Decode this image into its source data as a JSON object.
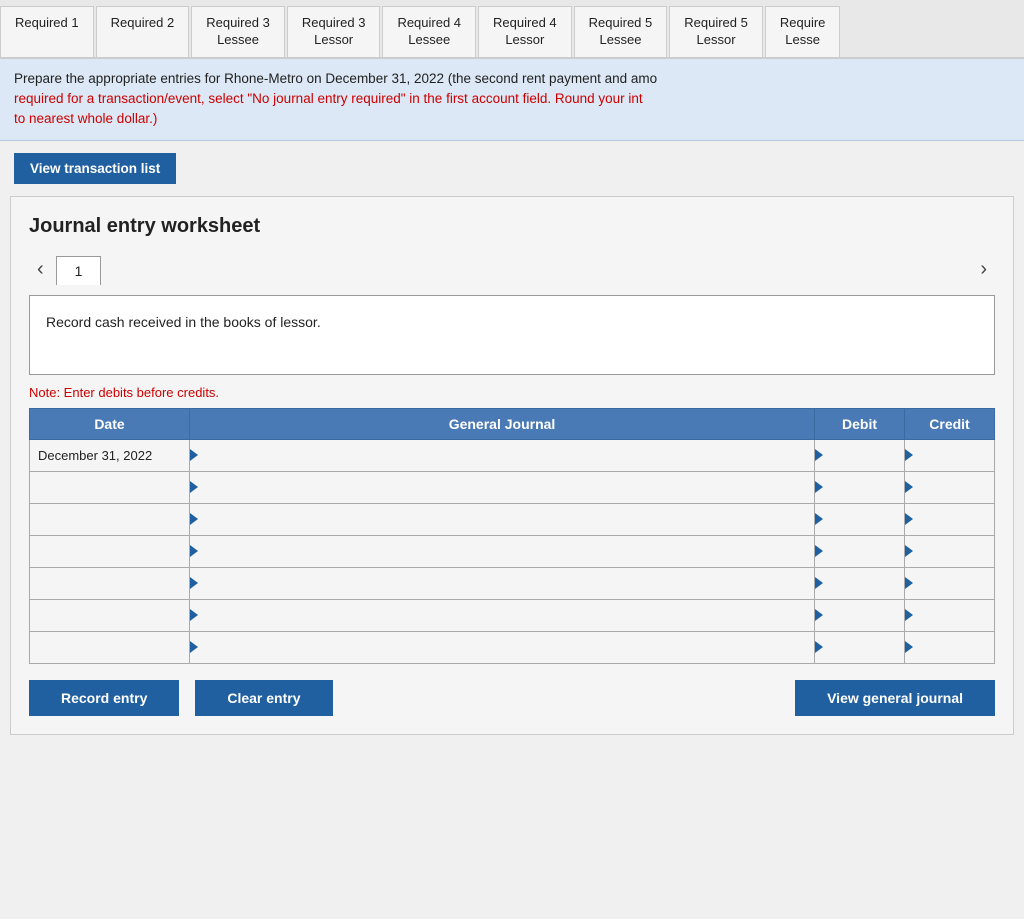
{
  "tabs": [
    {
      "id": "req1",
      "label": "Required 1"
    },
    {
      "id": "req2",
      "label": "Required 2"
    },
    {
      "id": "req3-lessee",
      "label": "Required 3\nLessee"
    },
    {
      "id": "req3-lessor",
      "label": "Required 3\nLessor"
    },
    {
      "id": "req4-lessee",
      "label": "Required 4\nLessee"
    },
    {
      "id": "req4-lessor",
      "label": "Required 4\nLessor"
    },
    {
      "id": "req5-lessee",
      "label": "Required 5\nLessee"
    },
    {
      "id": "req5-lessor",
      "label": "Required 5\nLessor"
    },
    {
      "id": "req-lesse2",
      "label": "Require\nLesse"
    }
  ],
  "instructions": {
    "main_text": "Prepare the appropriate entries for Rhone-Metro on December 31, 2022 (the second rent payment and amo",
    "red_text": "required for a transaction/event, select \"No journal entry required\" in the first account field. Round your int",
    "red_text2": "to nearest whole dollar.)"
  },
  "view_transaction_btn": "View transaction list",
  "worksheet": {
    "title": "Journal entry worksheet",
    "current_tab": "1",
    "transaction_description": "Record cash received in the books of lessor.",
    "note": "Note: Enter debits before credits.",
    "table": {
      "headers": [
        "Date",
        "General Journal",
        "Debit",
        "Credit"
      ],
      "rows": [
        {
          "date": "December 31, 2022",
          "journal": "",
          "debit": "",
          "credit": ""
        },
        {
          "date": "",
          "journal": "",
          "debit": "",
          "credit": ""
        },
        {
          "date": "",
          "journal": "",
          "debit": "",
          "credit": ""
        },
        {
          "date": "",
          "journal": "",
          "debit": "",
          "credit": ""
        },
        {
          "date": "",
          "journal": "",
          "debit": "",
          "credit": ""
        },
        {
          "date": "",
          "journal": "",
          "debit": "",
          "credit": ""
        },
        {
          "date": "",
          "journal": "",
          "debit": "",
          "credit": ""
        }
      ]
    }
  },
  "buttons": {
    "record_entry": "Record entry",
    "clear_entry": "Clear entry",
    "view_general_journal": "View general journal"
  }
}
